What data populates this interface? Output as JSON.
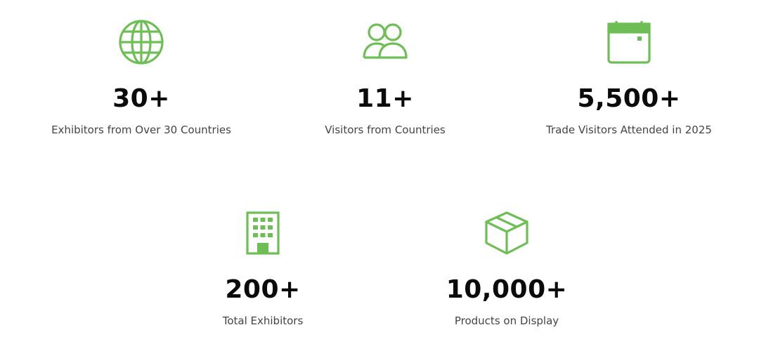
{
  "accent_color": "#6dbf55",
  "stats": [
    {
      "icon": "globe-icon",
      "value": "30+",
      "label": "Exhibitors from Over 30 Countries"
    },
    {
      "icon": "users-icon",
      "value": "11+",
      "label": "Visitors from Countries"
    },
    {
      "icon": "calendar-icon",
      "value": "5,500+",
      "label": "Trade Visitors Attended in 2025"
    },
    {
      "icon": "building-icon",
      "value": "200+",
      "label": "Total Exhibitors"
    },
    {
      "icon": "box-icon",
      "value": "10,000+",
      "label": "Products on Display"
    }
  ]
}
